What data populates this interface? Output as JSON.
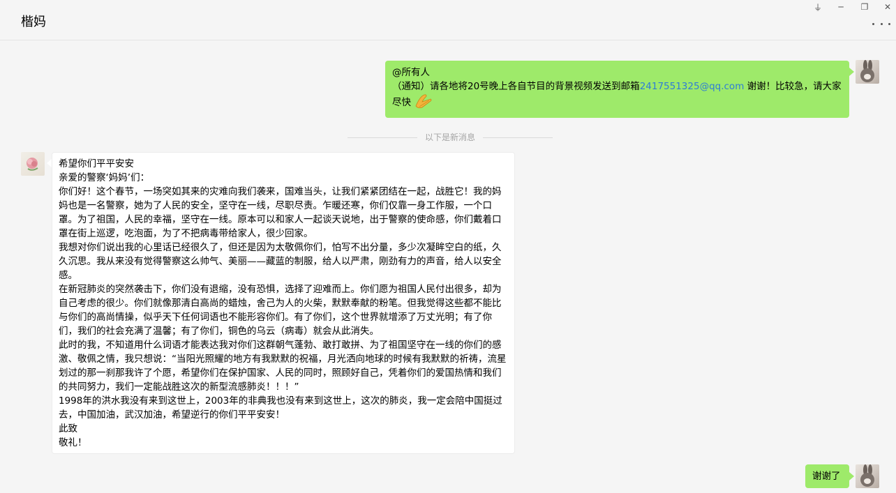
{
  "window": {
    "title": "楷妈",
    "controls": {
      "pin": "⏚",
      "minimize": "─",
      "restore": "❐",
      "close": "✕"
    }
  },
  "messages": [
    {
      "sender": "self",
      "line1": "@所有人",
      "line2_prefix": "（通知）请各地将20号晚上各自节目的背景视频发送到邮箱",
      "email": "2417551325@qq.com",
      "line2_suffix": " 谢谢！比较急，请大家尽快",
      "emoji": "clasped-hands"
    },
    {
      "divider": "以下是新消息"
    },
    {
      "sender": "other",
      "paragraphs": [
        "希望你们平平安安",
        "亲爱的警察‘妈妈’们：",
        "你们好！这个春节，一场突如其来的灾难向我们袭来，国难当头，让我们紧紧团结在一起，战胜它！我的妈妈也是一名警察，她为了人民的安全，坚守在一线，尽职尽责。乍暖还寒，你们仅靠一身工作服，一个口罩。为了祖国，人民的幸福，坚守在一线。原本可以和家人一起谈天说地，出于警察的使命感，你们戴着口罩在街上巡逻，吃泡面，为了不把病毒带给家人，很少回家。",
        "我想对你们说出我的心里话已经很久了，但还是因为太敬佩你们，怕写不出分量，多少次凝眸空白的纸，久久沉思。我从来没有觉得警察这么帅气、美丽——藏蓝的制服，给人以严肃，刚劲有力的声音，给人以安全感。",
        "在新冠肺炎的突然袭击下，你们没有退缩，没有恐惧，选择了迎难而上。你们愿为祖国人民付出很多，却为自己考虑的很少。你们就像那清白高尚的蜡烛，舍己为人的火柴，默默奉献的粉笔。但我觉得这些都不能比与你们的高尚情操，似乎天下任何词语也不能形容你们。有了你们，这个世界就增添了万丈光明；有了你们，我们的社会充满了温馨；有了你们，铜色的乌云（病毒）就会从此消失。",
        "此时的我，不知道用什么词语才能表达我对你们这群朝气蓬勃、敢打敢拼、为了祖国坚守在一线的你们的感激、敬佩之情，我只想说：“当阳光照耀的地方有我默默的祝福，月光洒向地球的时候有我默默的祈祷，流星划过的那一刹那我许了个愿，希望你们在保护国家、人民的同时，照顾好自己，凭着你们的爱国热情和我们的共同努力，我们一定能战胜这次的新型流感肺炎！！！”",
        "1998年的洪水我没有来到这世上，2003年的非典我也没有来到这世上，这次的肺炎，我一定会陪中国挺过去，中国加油，武汉加油，希望逆行的你们平平安安！",
        "此致",
        "敬礼！"
      ]
    },
    {
      "sender": "self",
      "text": "谢谢了"
    }
  ],
  "colors": {
    "self_bubble": "#9eea6a",
    "other_bubble": "#ffffff",
    "background": "#f5f5f5",
    "link": "#2e7dd6"
  }
}
